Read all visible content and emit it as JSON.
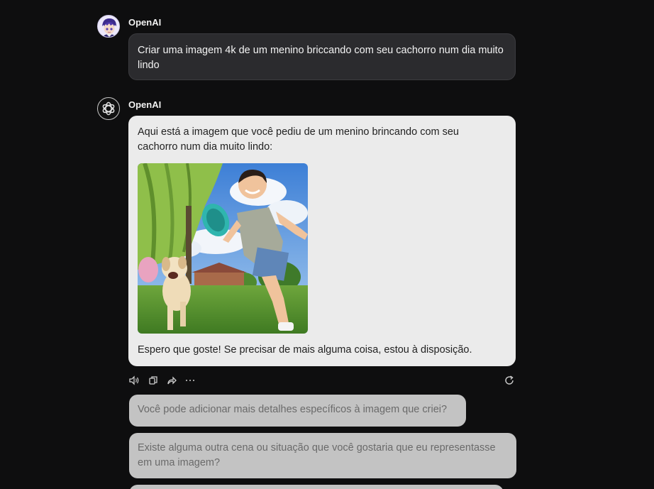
{
  "conversation": {
    "user_message": {
      "sender": "OpenAI",
      "text": "Criar uma imagem 4k de um menino briccando com seu cachorro num dia muito lindo"
    },
    "assistant_message": {
      "sender": "OpenAI",
      "intro": "Aqui está a imagem que você pediu de um menino brincando com seu cachorro num dia muito lindo:",
      "outro": "Espero que goste! Se precisar de mais alguma coisa, estou à disposição.",
      "image_icon": "generated-image-boy-dog-frisbee"
    },
    "actions": {
      "icons": [
        "speaker-icon",
        "copy-icon",
        "share-icon",
        "more-icon",
        "regenerate-icon"
      ]
    },
    "suggestions": [
      "Você pode adicionar mais detalhes específicos à imagem que criei?",
      "Existe alguma outra cena ou situação que você gostaria que eu representasse em uma imagem?",
      ""
    ]
  },
  "colors": {
    "background": "#0e0e0f",
    "user_bubble": "#2b2b2e",
    "assistant_bubble": "#ebebeb",
    "suggestion_bubble": "#c3c3c3"
  }
}
